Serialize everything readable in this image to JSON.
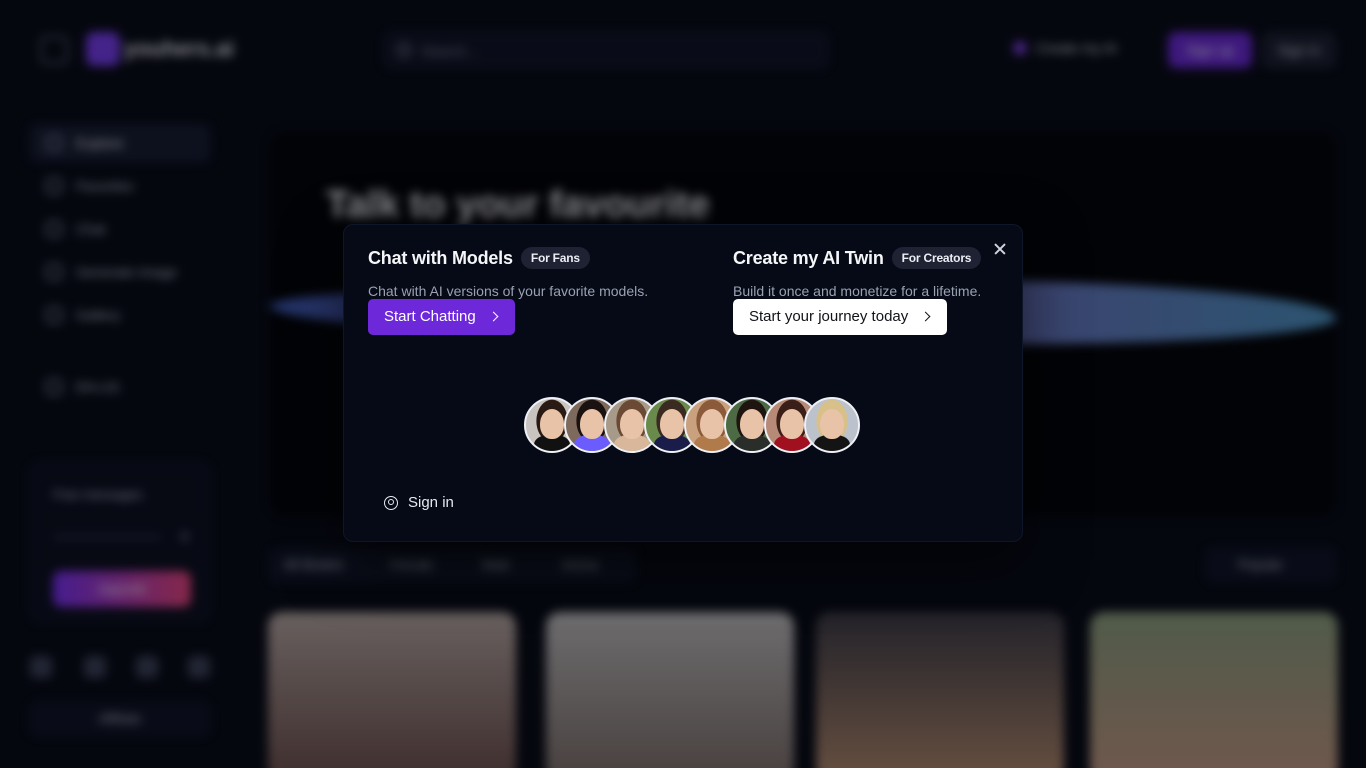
{
  "background": {
    "logo_text": "youhers.ai",
    "search_placeholder": "Search...",
    "create_ai_label": "Create my AI",
    "signup_label": "Sign up",
    "signin_label": "Sign in",
    "nav": [
      {
        "label": "Explore",
        "icon": "compass-icon"
      },
      {
        "label": "Favorites",
        "icon": "heart-icon"
      },
      {
        "label": "Chat",
        "icon": "chat-icon"
      },
      {
        "label": "Generate Image",
        "icon": "image-icon"
      },
      {
        "label": "Gallery",
        "icon": "gallery-icon"
      }
    ],
    "language_label": "EN-US",
    "free_messages_label": "Free messages",
    "free_messages_count": "0",
    "upgrade_label": "Upgrade",
    "affiliate_label": "Affiliate",
    "hero_title": "Talk to your favourite",
    "filter_chips": [
      "All Models",
      "Female",
      "Male",
      "Anime"
    ],
    "sort_label": "Popular"
  },
  "modal": {
    "fans": {
      "title": "Chat with Models",
      "badge": "For Fans",
      "subtitle": "Chat with AI versions of your favorite models.",
      "cta": "Start Chatting"
    },
    "creators": {
      "title": "Create my AI Twin",
      "badge": "For Creators",
      "subtitle": "Build it once and monetize for a lifetime.",
      "cta": "Start your journey today"
    },
    "avatars": [
      {
        "hair": "#2a1a14",
        "body": "#111111",
        "bg": "#c9c4c0"
      },
      {
        "hair": "#1a1210",
        "body": "#6b5cff",
        "bg": "#7d6a5c"
      },
      {
        "hair": "#6a4a35",
        "body": "#d9b79a",
        "bg": "#a79a88"
      },
      {
        "hair": "#3a2a22",
        "body": "#1a1c4a",
        "bg": "#6a8a4c"
      },
      {
        "hair": "#8a5a3a",
        "body": "#b07a4a",
        "bg": "#c9a17f"
      },
      {
        "hair": "#1e1410",
        "body": "#2a2e2a",
        "bg": "#4c6a44"
      },
      {
        "hair": "#3a1e18",
        "body": "#a0101e",
        "bg": "#b78a78"
      },
      {
        "hair": "#d8c08a",
        "body": "#141414",
        "bg": "#bcc2cc"
      }
    ],
    "signin_label": "Sign in",
    "colors": {
      "accent": "#6d28d9",
      "badge_bg": "#1e2233",
      "modal_bg": "#060a16"
    }
  }
}
